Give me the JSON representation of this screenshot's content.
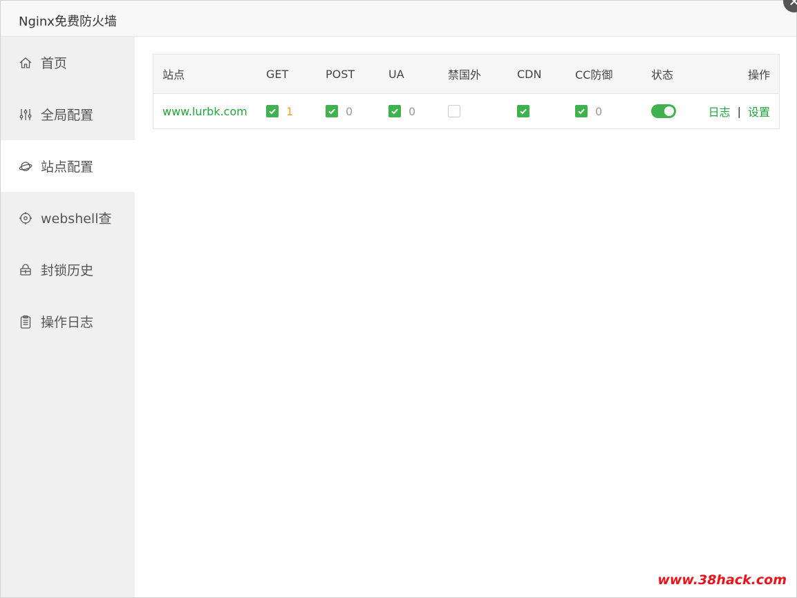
{
  "window": {
    "title": "Nginx免费防火墙",
    "close_glyph": "✕"
  },
  "sidebar": {
    "items": [
      {
        "label": "首页",
        "icon": "home-icon",
        "active": false
      },
      {
        "label": "全局配置",
        "icon": "sliders-icon",
        "active": false
      },
      {
        "label": "站点配置",
        "icon": "planet-icon",
        "active": true
      },
      {
        "label": "webshell查",
        "icon": "target-icon",
        "active": false
      },
      {
        "label": "封锁历史",
        "icon": "lock-history-icon",
        "active": false
      },
      {
        "label": "操作日志",
        "icon": "clipboard-icon",
        "active": false
      }
    ]
  },
  "table": {
    "headers": {
      "site": "站点",
      "get": "GET",
      "post": "POST",
      "ua": "UA",
      "foreign": "禁国外",
      "cdn": "CDN",
      "cc": "CC防御",
      "status": "状态",
      "ops": "操作"
    },
    "rows": [
      {
        "site": "www.lurbk.com",
        "get": {
          "checked": true,
          "count": "1"
        },
        "post": {
          "checked": true,
          "count": "0"
        },
        "ua": {
          "checked": true,
          "count": "0"
        },
        "foreign": {
          "checked": false
        },
        "cdn": {
          "checked": true
        },
        "cc": {
          "checked": true,
          "count": "0"
        },
        "status_on": true,
        "ops": {
          "log": "日志",
          "sep": "|",
          "settings": "设置"
        }
      }
    ]
  },
  "colors": {
    "accent": "#20a53a",
    "check": "#3fb14e",
    "warn": "#f0a020",
    "watermark": "#e8141c"
  },
  "watermark": "www.38hack.com"
}
